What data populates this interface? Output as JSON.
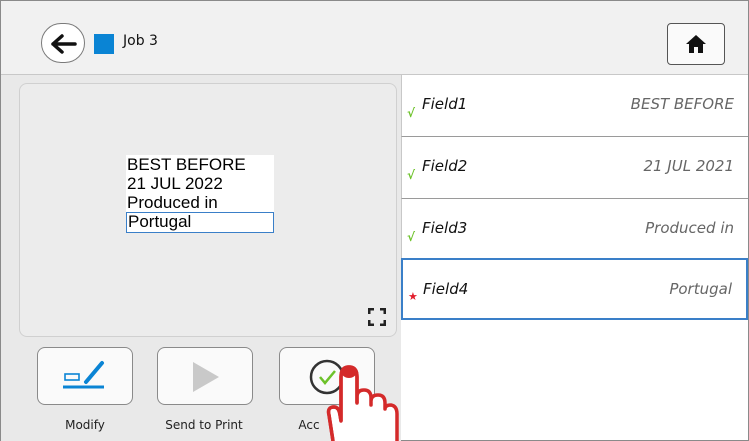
{
  "header": {
    "job_title": "Job 3",
    "job_color": "#0a84d4",
    "back_icon": "arrow-left-icon",
    "home_icon": "home-icon"
  },
  "preview": {
    "lines": [
      "BEST BEFORE",
      "21 JUL 2022",
      "Produced in",
      "Portugal"
    ],
    "expand_icon": "fullscreen-icon"
  },
  "actions": [
    {
      "label": "Modify",
      "icon": "edit-icon"
    },
    {
      "label": "Send to Print",
      "icon": "play-icon"
    },
    {
      "label": "Acc",
      "icon": "accept-icon"
    }
  ],
  "fields": [
    {
      "name": "Field1",
      "value": "BEST BEFORE",
      "status": "√"
    },
    {
      "name": "Field2",
      "value": "21 JUL 2021",
      "status": "√"
    },
    {
      "name": "Field3",
      "value": "Produced in",
      "status": "√"
    },
    {
      "name": "Field4",
      "value": "Portugal",
      "status": "★"
    }
  ]
}
